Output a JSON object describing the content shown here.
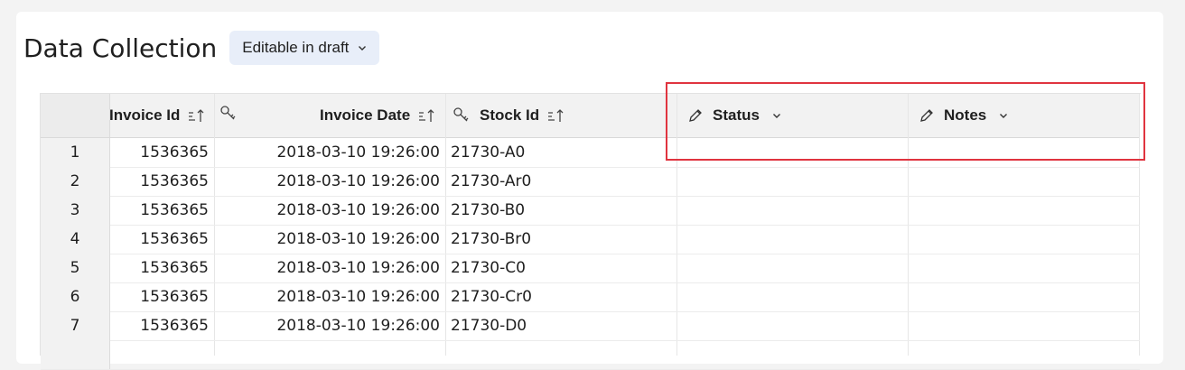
{
  "page": {
    "title": "Data Collection",
    "mode_label": "Editable in draft"
  },
  "columns": {
    "invoice_id": "Invoice Id",
    "invoice_date": "Invoice Date",
    "stock_id": "Stock Id",
    "status": "Status",
    "notes": "Notes"
  },
  "rows": [
    {
      "num": "1",
      "invoice_id": "1536365",
      "invoice_date": "2018-03-10 19:26:00",
      "stock_id": "21730-A0",
      "status": "",
      "notes": ""
    },
    {
      "num": "2",
      "invoice_id": "1536365",
      "invoice_date": "2018-03-10 19:26:00",
      "stock_id": "21730-Ar0",
      "status": "",
      "notes": ""
    },
    {
      "num": "3",
      "invoice_id": "1536365",
      "invoice_date": "2018-03-10 19:26:00",
      "stock_id": "21730-B0",
      "status": "",
      "notes": ""
    },
    {
      "num": "4",
      "invoice_id": "1536365",
      "invoice_date": "2018-03-10 19:26:00",
      "stock_id": "21730-Br0",
      "status": "",
      "notes": ""
    },
    {
      "num": "5",
      "invoice_id": "1536365",
      "invoice_date": "2018-03-10 19:26:00",
      "stock_id": "21730-C0",
      "status": "",
      "notes": ""
    },
    {
      "num": "6",
      "invoice_id": "1536365",
      "invoice_date": "2018-03-10 19:26:00",
      "stock_id": "21730-Cr0",
      "status": "",
      "notes": ""
    },
    {
      "num": "7",
      "invoice_id": "1536365",
      "invoice_date": "2018-03-10 19:26:00",
      "stock_id": "21730-D0",
      "status": "",
      "notes": ""
    }
  ],
  "colors": {
    "highlight": "#e0343f",
    "mode_button_bg": "#e8eef9",
    "header_bg": "#f2f2f2"
  }
}
